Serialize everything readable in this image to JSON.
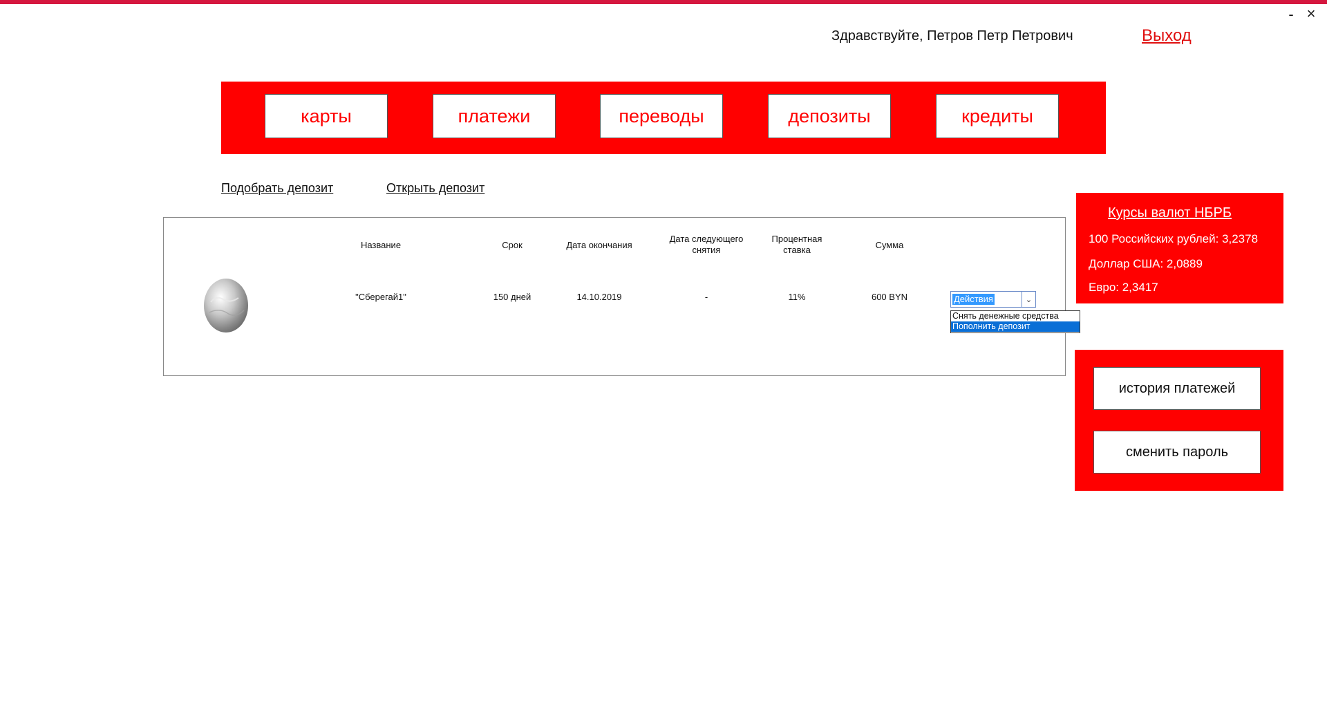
{
  "window": {
    "minimize_label": "-",
    "close_label": "×",
    "accent_color": "#d5173f"
  },
  "header": {
    "greeting": "Здравствуйте, Петров Петр Петрович",
    "logout": "Выход"
  },
  "nav": {
    "items": [
      {
        "label": "карты"
      },
      {
        "label": "платежи"
      },
      {
        "label": "переводы"
      },
      {
        "label": "депозиты"
      },
      {
        "label": "кредиты"
      }
    ],
    "panel_color": "#ff0000"
  },
  "deposit_links": {
    "choose": "Подобрать депозит",
    "open": "Открыть депозит"
  },
  "deposit_table": {
    "columns": {
      "name": "Название",
      "term": "Срок",
      "end_date": "Дата окончания",
      "next_withdraw_1": "Дата следующего",
      "next_withdraw_2": "снятия",
      "rate_1": "Процентная",
      "rate_2": "ставка",
      "amount": "Сумма"
    },
    "row": {
      "icon": "silver-egg-icon",
      "name": "\"Сберегай1\"",
      "term": "150 дней",
      "end_date": "14.10.2019",
      "next_withdraw": "-",
      "rate": "11%",
      "amount": "600 BYN"
    },
    "actions_select": {
      "value": "Действия",
      "options": [
        "Снять денежные средства",
        "Пополнить депозит"
      ],
      "highlighted_option": "Пополнить депозит"
    }
  },
  "rates": {
    "title": "Курсы валют НБРБ",
    "lines": [
      "100 Российских рублей: 3,2378",
      "Доллар США: 2,0889",
      "Евро: 2,3417"
    ]
  },
  "side_actions": {
    "history": "история платежей",
    "change_password": "сменить пароль"
  }
}
